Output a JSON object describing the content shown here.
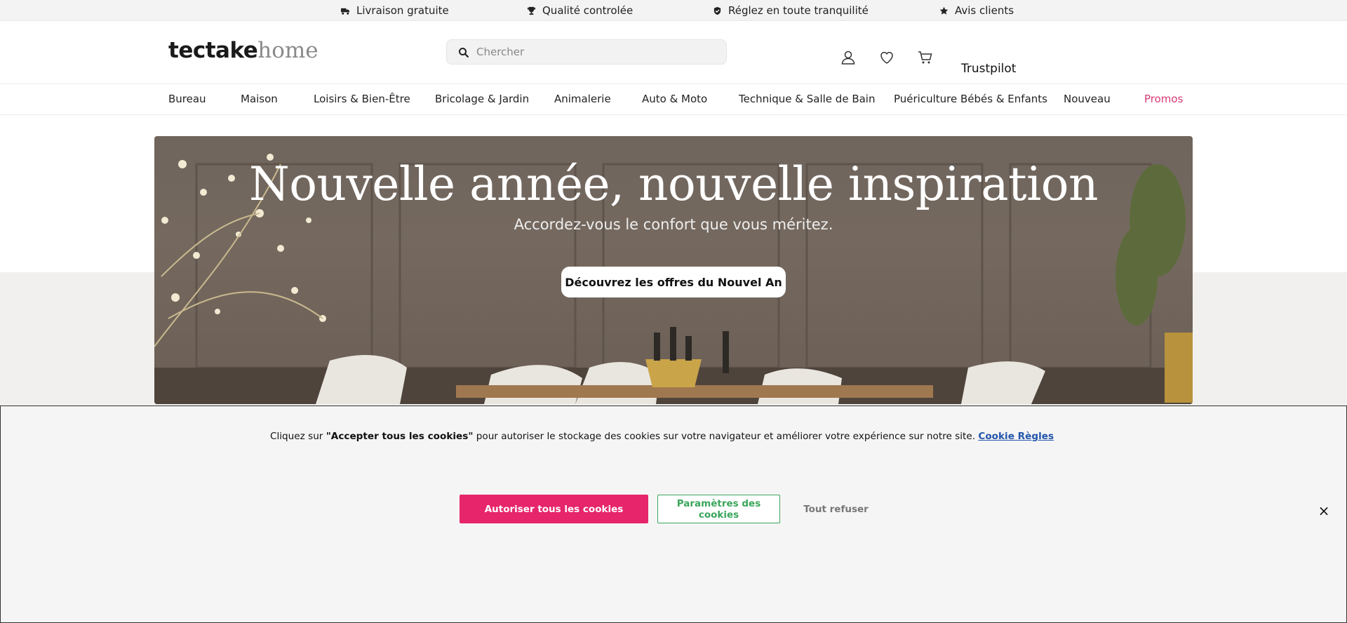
{
  "topbar": {
    "items": [
      {
        "label": "Livraison gratuite",
        "icon": "truck-icon"
      },
      {
        "label": "Qualité controlée",
        "icon": "trophy-icon"
      },
      {
        "label": "Réglez en toute tranquilité",
        "icon": "shield-icon"
      },
      {
        "label": "Avis clients",
        "icon": "star-icon"
      }
    ]
  },
  "header": {
    "logo_bold": "tectake",
    "logo_light": "home",
    "search_placeholder": "Chercher",
    "trustpilot": "Trustpilot",
    "icons": [
      "user-icon",
      "heart-icon",
      "cart-icon"
    ]
  },
  "nav": {
    "items": [
      "Bureau",
      "Maison",
      "Loisirs & Bien-Être",
      "Bricolage & Jardin",
      "Animalerie",
      "Auto & Moto",
      "Technique & Salle de Bain",
      "Puériculture Bébés & Enfants",
      "Nouveau",
      "Promos"
    ]
  },
  "hero": {
    "title": "Nouvelle année, nouvelle inspiration",
    "subtitle": "Accordez-vous le confort que vous méritez.",
    "cta": "Découvrez les offres du Nouvel An"
  },
  "cookie": {
    "text_prefix": "Cliquez sur ",
    "text_bold": "\"Accepter tous les cookies\"",
    "text_suffix": " pour autoriser le stockage des cookies sur votre navigateur et améliorer votre expérience sur notre site. ",
    "link": "Cookie Règles",
    "accept": "Autoriser tous les cookies",
    "settings": "Paramètres des cookies",
    "refuse": "Tout refuser",
    "close": "×"
  },
  "colors": {
    "accent": "#e6256a",
    "promo": "#d63b74",
    "settings_green": "#3aa55a",
    "link_blue": "#2255aa"
  }
}
